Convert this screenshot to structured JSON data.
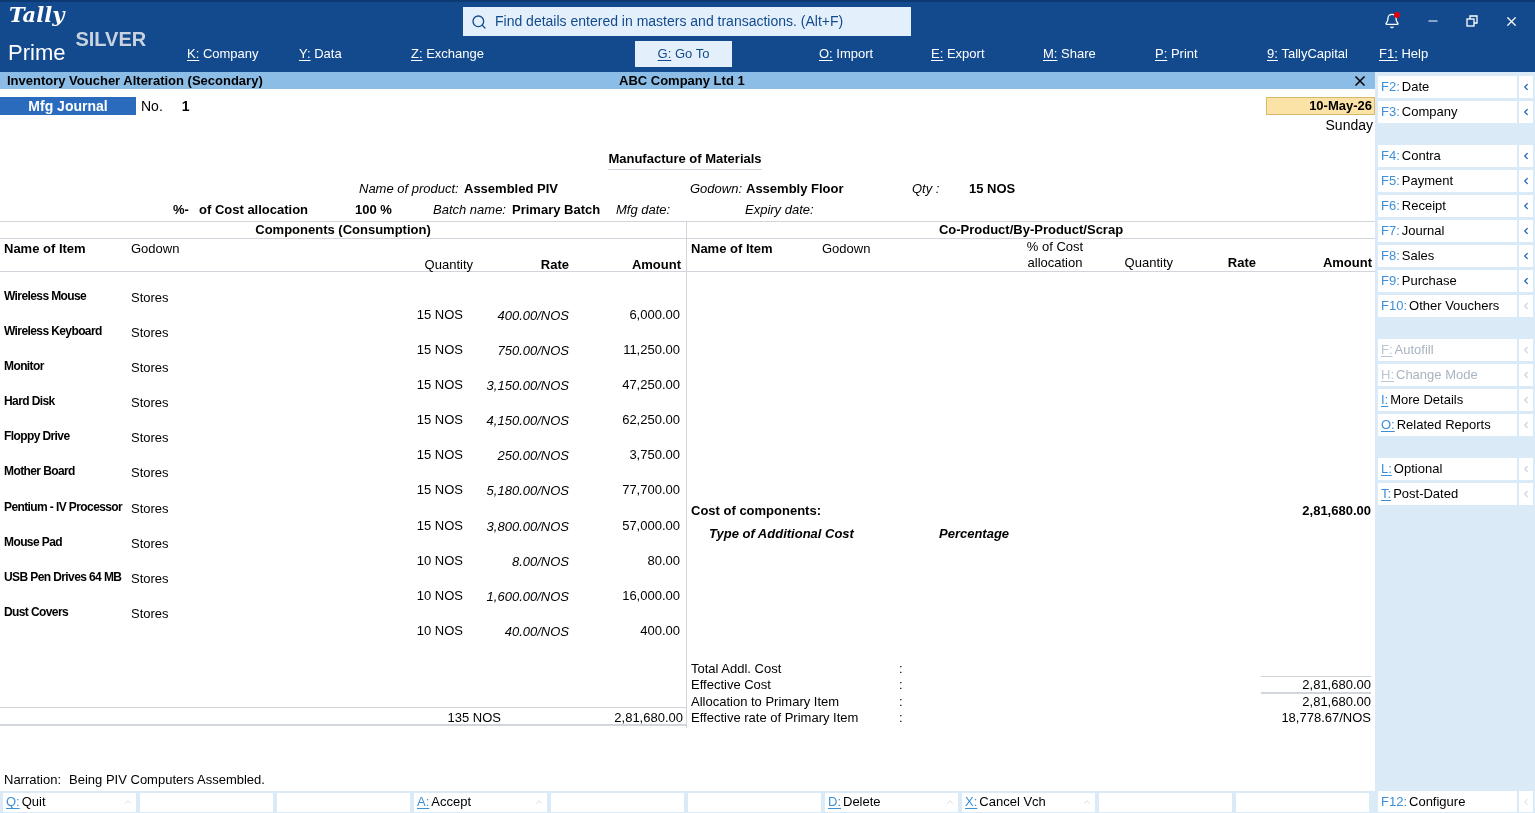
{
  "brand": {
    "logo_script": "Tally",
    "logo_word": "Prime",
    "edition": "SILVER"
  },
  "search": {
    "placeholder": "Find details entered in masters and transactions. (Alt+F)"
  },
  "menu": [
    {
      "key": "K:",
      "label": "Company",
      "selected": false
    },
    {
      "key": "Y:",
      "label": "Data",
      "selected": false
    },
    {
      "key": "Z:",
      "label": "Exchange",
      "selected": false
    },
    {
      "key": "G:",
      "label": "Go To",
      "selected": true
    },
    {
      "key": "O:",
      "label": "Import",
      "selected": false
    },
    {
      "key": "E:",
      "label": "Export",
      "selected": false
    },
    {
      "key": "M:",
      "label": "Share",
      "selected": false
    },
    {
      "key": "P:",
      "label": "Print",
      "selected": false
    },
    {
      "key": "9:",
      "label": "TallyCapital",
      "selected": false
    },
    {
      "key": "F1:",
      "label": "Help",
      "selected": false
    }
  ],
  "notification": {
    "unread": true
  },
  "title_bar": {
    "title": "Inventory Voucher Alteration (Secondary)",
    "company": "ABC Company Ltd 1"
  },
  "voucher": {
    "type": "Mfg Journal",
    "number_label": "No.",
    "number": "1",
    "date": "10-May-26",
    "day": "Sunday",
    "heading": "Manufacture of Materials",
    "product_label": "Name of product:",
    "product": "Assembled PIV",
    "godown_label": "Godown:",
    "godown": "Assembly Floor",
    "qty_label": "Qty :",
    "qty": "15 NOS",
    "alloc_prefix": "%-",
    "alloc_label": "of Cost allocation",
    "alloc_value": "100 %",
    "batch_label": "Batch name:",
    "batch": "Primary Batch",
    "mfg_label": "Mfg date:",
    "expiry_label": "Expiry date:"
  },
  "components": {
    "title": "Components (Consumption)",
    "columns": [
      "Name of Item",
      "Godown",
      "Quantity",
      "Rate",
      "Amount"
    ],
    "rows": [
      {
        "name": "Wireless Mouse",
        "godown": "Stores",
        "quantity": "15 NOS",
        "rate": "400.00/NOS",
        "amount": "6,000.00"
      },
      {
        "name": "Wireless Keyboard",
        "godown": "Stores",
        "quantity": "15 NOS",
        "rate": "750.00/NOS",
        "amount": "11,250.00"
      },
      {
        "name": "Monitor",
        "godown": "Stores",
        "quantity": "15 NOS",
        "rate": "3,150.00/NOS",
        "amount": "47,250.00"
      },
      {
        "name": "Hard Disk",
        "godown": "Stores",
        "quantity": "15 NOS",
        "rate": "4,150.00/NOS",
        "amount": "62,250.00"
      },
      {
        "name": "Floppy Drive",
        "godown": "Stores",
        "quantity": "15 NOS",
        "rate": "250.00/NOS",
        "amount": "3,750.00"
      },
      {
        "name": "Mother Board",
        "godown": "Stores",
        "quantity": "15 NOS",
        "rate": "5,180.00/NOS",
        "amount": "77,700.00"
      },
      {
        "name": "Pentium - IV Processor",
        "godown": "Stores",
        "quantity": "15 NOS",
        "rate": "3,800.00/NOS",
        "amount": "57,000.00"
      },
      {
        "name": "Mouse Pad",
        "godown": "Stores",
        "quantity": "10 NOS",
        "rate": "8.00/NOS",
        "amount": "80.00"
      },
      {
        "name": "USB Pen Drives 64 MB",
        "godown": "Stores",
        "quantity": "10 NOS",
        "rate": "1,600.00/NOS",
        "amount": "16,000.00"
      },
      {
        "name": "Dust Covers",
        "godown": "Stores",
        "quantity": "10 NOS",
        "rate": "40.00/NOS",
        "amount": "400.00"
      }
    ],
    "total_quantity": "135 NOS",
    "total_amount": "2,81,680.00"
  },
  "coproducts": {
    "title": "Co-Product/By-Product/Scrap",
    "columns": [
      "Name of Item",
      "Godown",
      "% of Cost allocation",
      "Quantity",
      "Rate",
      "Amount"
    ],
    "cost_label": "Cost of components:",
    "cost_value": "2,81,680.00",
    "addl_columns": [
      "Type of Additional Cost",
      "Percentage"
    ],
    "summary": [
      {
        "label": "Total Addl. Cost",
        "sep": ":"
      },
      {
        "label": "Effective Cost",
        "sep": ":",
        "value": "2,81,680.00"
      },
      {
        "label": "Allocation to Primary Item",
        "sep": ":",
        "value": "2,81,680.00"
      },
      {
        "label": "Effective rate of Primary Item",
        "sep": ":",
        "value": "18,778.67/NOS"
      }
    ]
  },
  "narration": {
    "label": "Narration:",
    "text": "Being PIV Computers Assembled."
  },
  "bottom_bar": [
    {
      "kind": "action",
      "key": "Q:",
      "label": "Quit"
    },
    {
      "kind": "empty"
    },
    {
      "kind": "empty"
    },
    {
      "kind": "action",
      "key": "A:",
      "label": "Accept"
    },
    {
      "kind": "empty"
    },
    {
      "kind": "empty"
    },
    {
      "kind": "action",
      "key": "D:",
      "label": "Delete"
    },
    {
      "kind": "action",
      "key": "X:",
      "label": "Cancel Vch"
    },
    {
      "kind": "empty"
    },
    {
      "kind": "empty"
    }
  ],
  "sidebar": {
    "groups": [
      [
        {
          "key": "F2:",
          "label": "Date",
          "disabled": false,
          "expandable": true
        },
        {
          "key": "F3:",
          "label": "Company",
          "disabled": false,
          "expandable": true
        }
      ],
      [
        {
          "key": "F4:",
          "label": "Contra",
          "disabled": false,
          "expandable": true
        },
        {
          "key": "F5:",
          "label": "Payment",
          "disabled": false,
          "expandable": true
        },
        {
          "key": "F6:",
          "label": "Receipt",
          "disabled": false,
          "expandable": true
        },
        {
          "key": "F7:",
          "label": "Journal",
          "disabled": false,
          "expandable": true
        },
        {
          "key": "F8:",
          "label": "Sales",
          "disabled": false,
          "expandable": true
        },
        {
          "key": "F9:",
          "label": "Purchase",
          "disabled": false,
          "expandable": true
        },
        {
          "key": "F10:",
          "label": "Other Vouchers",
          "disabled": false,
          "expandable": false
        }
      ],
      [
        {
          "key": "F:",
          "label": "Autofill",
          "disabled": true,
          "expandable": false
        },
        {
          "key": "H:",
          "label": "Change Mode",
          "disabled": true,
          "expandable": false
        },
        {
          "key": "I:",
          "label": "More Details",
          "disabled": false,
          "expandable": false
        },
        {
          "key": "O:",
          "label": "Related Reports",
          "disabled": false,
          "expandable": false
        }
      ],
      [
        {
          "key": "L:",
          "label": "Optional",
          "disabled": false,
          "expandable": false
        },
        {
          "key": "T:",
          "label": "Post-Dated",
          "disabled": false,
          "expandable": false
        }
      ]
    ],
    "footer": {
      "key": "F12:",
      "label": "Configure"
    }
  }
}
